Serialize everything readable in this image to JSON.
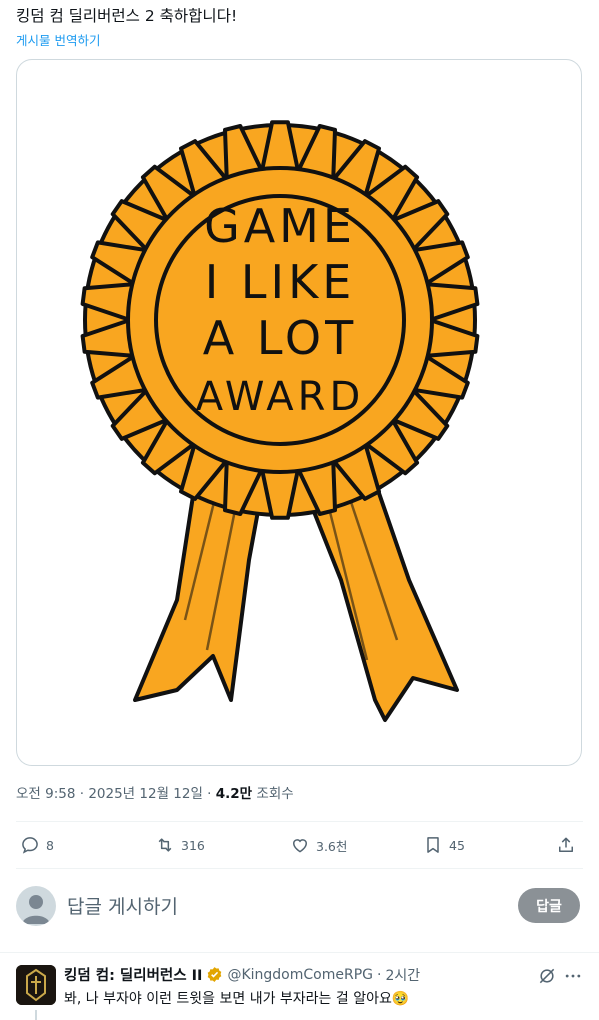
{
  "tweet": {
    "text": "킹덤 컴 딜리버런스 2 축하합니다!",
    "translate_label": "게시물 번역하기"
  },
  "media": {
    "award_lines": [
      "GAME",
      "I LIKE",
      "A LOT",
      "AWARD"
    ],
    "ribbon_color": "#f9a620"
  },
  "meta": {
    "time": "오전 9:58",
    "separator": " · ",
    "date": "2025년 12월 12일",
    "views_count": "4.2만",
    "views_label": " 조회수"
  },
  "actions": {
    "replies": "8",
    "reposts": "316",
    "likes": "3.6천",
    "bookmarks": "45"
  },
  "composer": {
    "placeholder": "답글 게시하기",
    "reply_button": "답글"
  },
  "reply": {
    "name": "킹덤 컴: 딜리버런스 II",
    "handle": "@KingdomComeRPG",
    "dot": "·",
    "time": "2시간",
    "text": "봐, 나 부자야  이런 트윗을 보면 내가 부자라는 걸 알아요🥹"
  },
  "colors": {
    "accent": "#1d9bf0",
    "muted": "#536471",
    "gold_badge": "#e2a500"
  }
}
